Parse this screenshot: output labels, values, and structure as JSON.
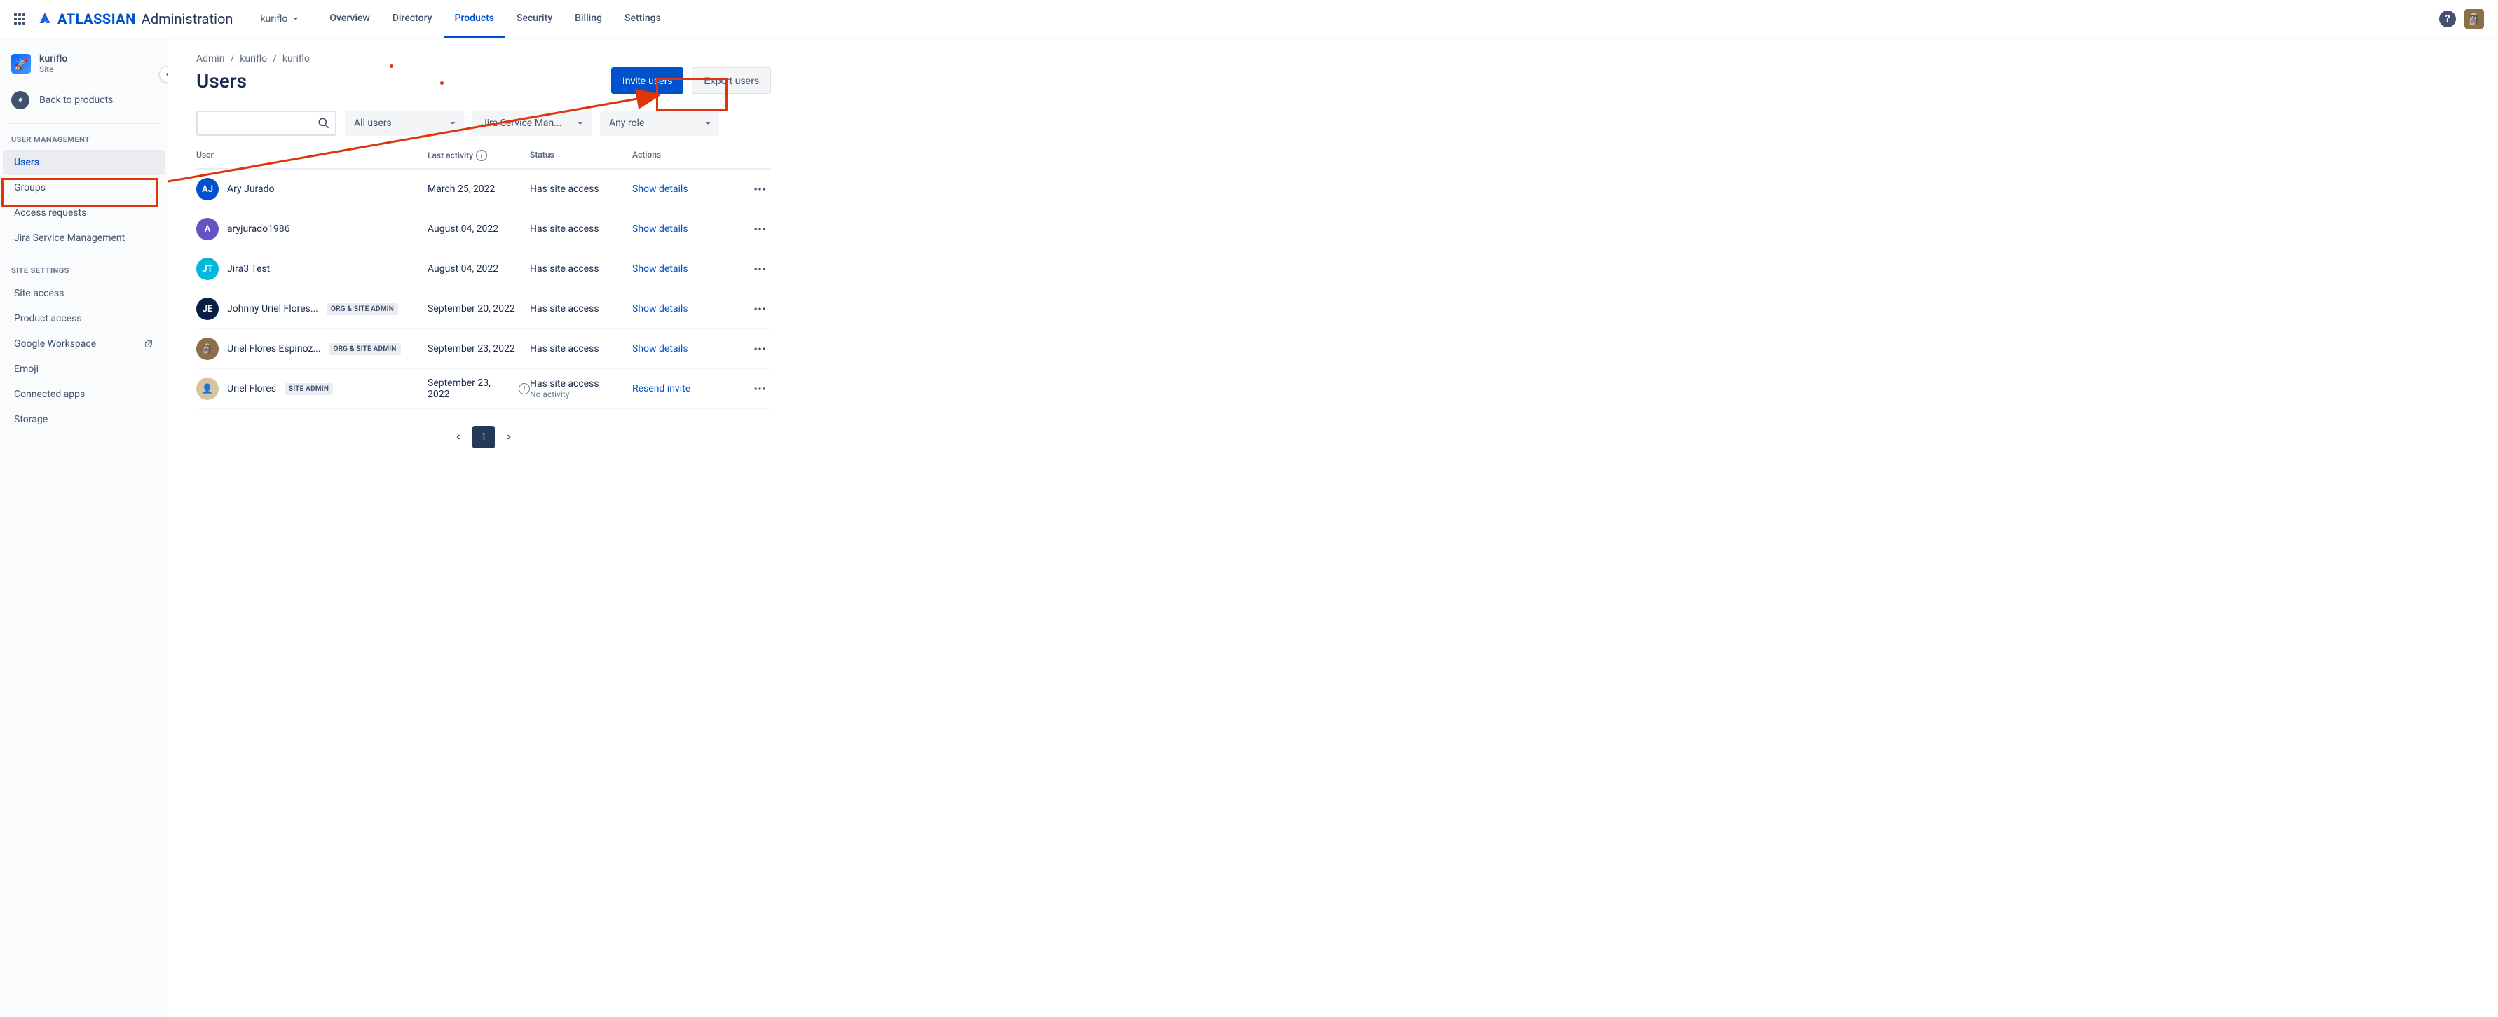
{
  "brand": {
    "logo_text": "ATLASSIAN",
    "word": "Administration"
  },
  "org_switcher": {
    "name": "kuriflo"
  },
  "topnav": {
    "tabs": [
      {
        "label": "Overview"
      },
      {
        "label": "Directory"
      },
      {
        "label": "Products",
        "active": true
      },
      {
        "label": "Security"
      },
      {
        "label": "Billing"
      },
      {
        "label": "Settings"
      }
    ]
  },
  "sidebar": {
    "site_name": "kuriflo",
    "site_type": "Site",
    "back_label": "Back to products",
    "sections": {
      "user_mgmt_label": "USER MANAGEMENT",
      "site_settings_label": "SITE SETTINGS"
    },
    "user_mgmt_items": [
      {
        "label": "Users",
        "active": true
      },
      {
        "label": "Groups"
      },
      {
        "label": "Access requests"
      },
      {
        "label": "Jira Service Management"
      }
    ],
    "site_items": [
      {
        "label": "Site access"
      },
      {
        "label": "Product access"
      },
      {
        "label": "Google Workspace",
        "external": true
      },
      {
        "label": "Emoji"
      },
      {
        "label": "Connected apps"
      },
      {
        "label": "Storage"
      }
    ]
  },
  "breadcrumbs": [
    {
      "label": "Admin"
    },
    {
      "label": "kuriflo"
    },
    {
      "label": "kuriflo"
    }
  ],
  "page": {
    "title": "Users",
    "invite_label": "Invite users",
    "export_label": "Export users"
  },
  "filters": {
    "search_placeholder": "",
    "users_filter": "All users",
    "product_filter": "Jira Service Man...",
    "role_filter": "Any role"
  },
  "table": {
    "headers": {
      "user": "User",
      "activity": "Last activity",
      "status": "Status",
      "actions": "Actions"
    },
    "rows": [
      {
        "name": "Ary Jurado",
        "initials": "AJ",
        "avatar_bg": "#0052CC",
        "badge": null,
        "activity": "March 25, 2022",
        "status": "Has site access",
        "action": "Show details"
      },
      {
        "name": "aryjurado1986",
        "initials": "A",
        "avatar_bg": "#6554C0",
        "badge": null,
        "activity": "August 04, 2022",
        "status": "Has site access",
        "action": "Show details"
      },
      {
        "name": "Jira3 Test",
        "initials": "JT",
        "avatar_bg": "#00B8D9",
        "badge": null,
        "activity": "August 04, 2022",
        "status": "Has site access",
        "action": "Show details"
      },
      {
        "name": "Johnny Uriel Flores...",
        "initials": "JE",
        "avatar_bg": "#091E42",
        "badge": "ORG & SITE ADMIN",
        "activity": "September 20, 2022",
        "status": "Has site access",
        "action": "Show details"
      },
      {
        "name": "Uriel Flores Espinoz...",
        "initials": "",
        "avatar_bg": "#8B6F47",
        "avatar_emoji": "🗿",
        "badge": "ORG & SITE ADMIN",
        "activity": "September 23, 2022",
        "status": "Has site access",
        "action": "Show details"
      },
      {
        "name": "Uriel Flores",
        "initials": "",
        "avatar_bg": "#D4C5A0",
        "avatar_emoji": "👤",
        "badge": "SITE ADMIN",
        "activity": "September 23, 2022",
        "activity_sub": "No activity",
        "activity_info": true,
        "status": "Has site access",
        "action": "Resend invite"
      }
    ]
  },
  "pagination": {
    "current": "1"
  }
}
